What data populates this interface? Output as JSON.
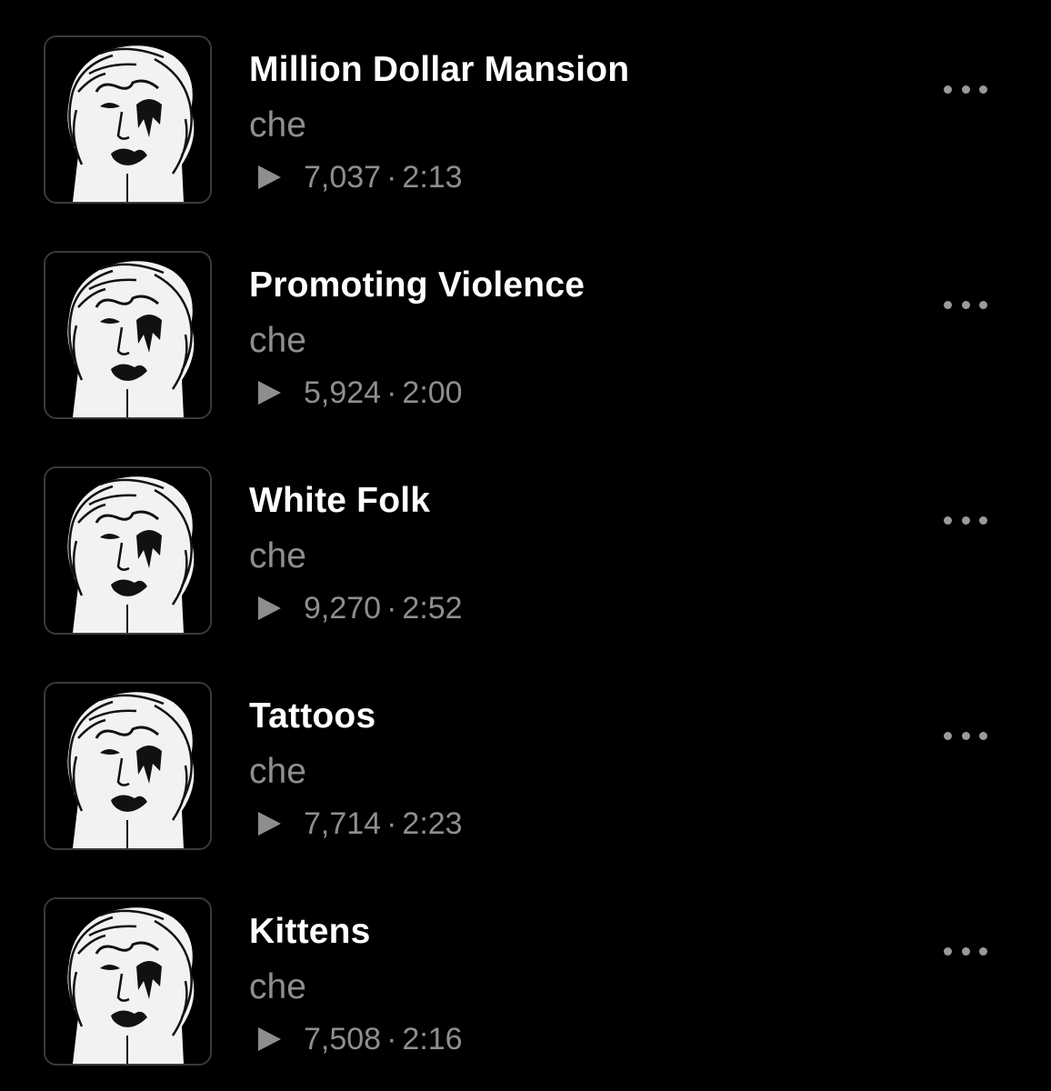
{
  "tracks": [
    {
      "title": "Million Dollar Mansion",
      "artist": "che",
      "plays": "7,037",
      "separator": "·",
      "duration": "2:13"
    },
    {
      "title": "Promoting Violence",
      "artist": "che",
      "plays": "5,924",
      "separator": "·",
      "duration": "2:00"
    },
    {
      "title": "White Folk",
      "artist": "che",
      "plays": "9,270",
      "separator": "·",
      "duration": "2:52"
    },
    {
      "title": "Tattoos",
      "artist": "che",
      "plays": "7,714",
      "separator": "·",
      "duration": "2:23"
    },
    {
      "title": "Kittens",
      "artist": "che",
      "plays": "7,508",
      "separator": "·",
      "duration": "2:16"
    }
  ],
  "icons": {
    "play": "play-icon",
    "more": "more-options-icon"
  },
  "colors": {
    "background": "#000000",
    "title": "#ffffff",
    "secondary": "#8e8e8e",
    "cover_border": "#3a3a3a"
  }
}
